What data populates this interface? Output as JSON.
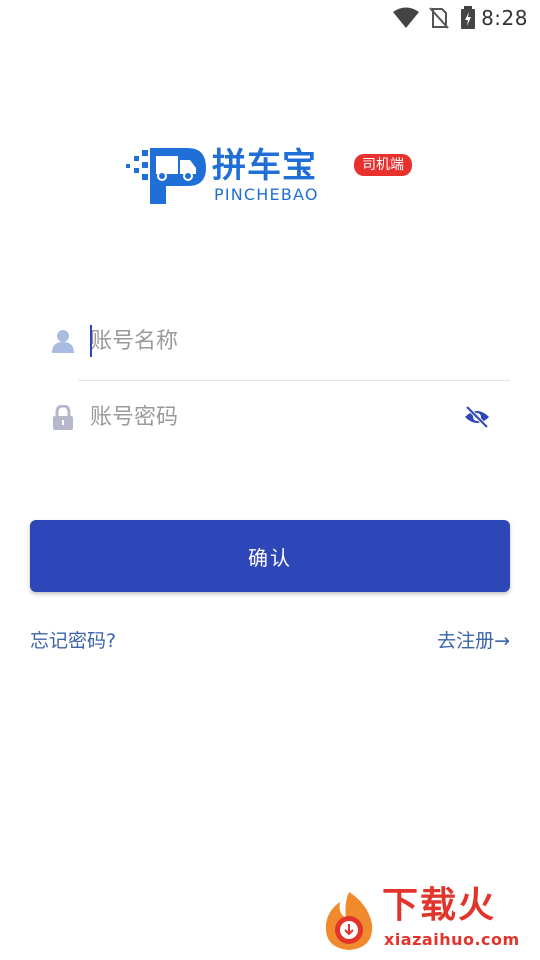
{
  "status_bar": {
    "time": "8:28",
    "icons": [
      "wifi-icon",
      "no-sim-icon",
      "battery-charging-icon"
    ]
  },
  "logo": {
    "name": "拼车宝",
    "sub": "PINCHEBAO",
    "badge": "司机端",
    "colors": {
      "brand": "#1f6fd6",
      "badge": "#e8302d"
    }
  },
  "form": {
    "account": {
      "placeholder": "账号名称",
      "value": ""
    },
    "password": {
      "placeholder": "账号密码",
      "value": ""
    }
  },
  "actions": {
    "confirm_label": "确认",
    "forgot_label": "忘记密码?",
    "register_label": "去注册→",
    "colors": {
      "primary": "#2d47b8",
      "link": "#3c64a8"
    }
  },
  "watermark": {
    "title": "下载火",
    "url": "xiazaihuo.com"
  }
}
